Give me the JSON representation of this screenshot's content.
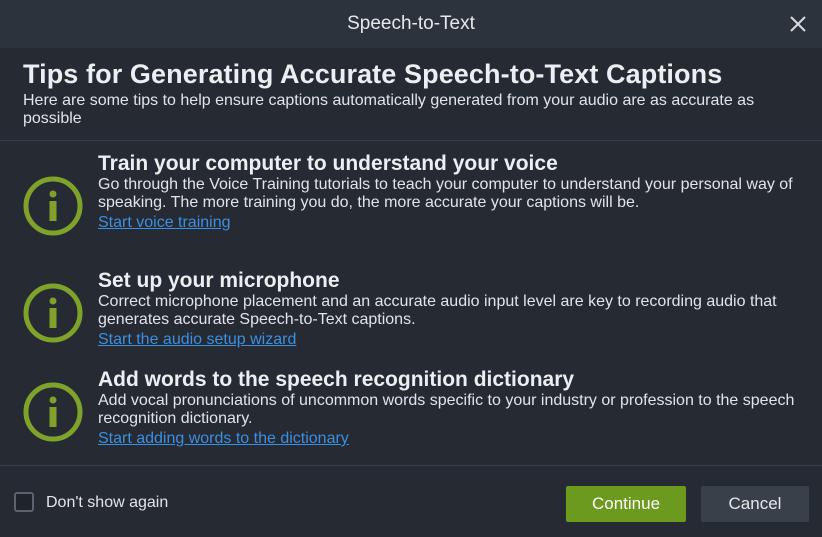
{
  "window": {
    "title": "Speech-to-Text",
    "close_icon": "close-icon"
  },
  "header": {
    "title": "Tips for Generating Accurate Speech-to-Text Captions",
    "subtitle": "Here are some tips to help ensure captions automatically generated from your audio are as accurate as possible"
  },
  "tips": [
    {
      "icon": "info-icon",
      "heading": "Train your computer to understand your voice",
      "body": "Go through the Voice Training tutorials to teach your computer to understand your personal way of speaking. The more training you do, the more accurate your captions will be.",
      "link": "Start voice training"
    },
    {
      "icon": "info-icon",
      "heading": "Set up your microphone",
      "body": "Correct microphone placement and an accurate audio input level are key to recording audio that generates accurate Speech-to-Text captions.",
      "link": "Start the audio setup wizard"
    },
    {
      "icon": "info-icon",
      "heading": "Add words to the speech recognition dictionary",
      "body": "Add vocal pronunciations of uncommon words specific to your industry or profession to the speech recognition dictionary.",
      "link": "Start adding words to the dictionary"
    }
  ],
  "footer": {
    "dont_show_label": "Don't show again",
    "dont_show_checked": false,
    "continue_label": "Continue",
    "cancel_label": "Cancel"
  },
  "colors": {
    "accent_green": "#6b9a1f",
    "icon_green": "#7fa32a",
    "link_blue": "#3d8fe0",
    "background": "#252a33"
  }
}
